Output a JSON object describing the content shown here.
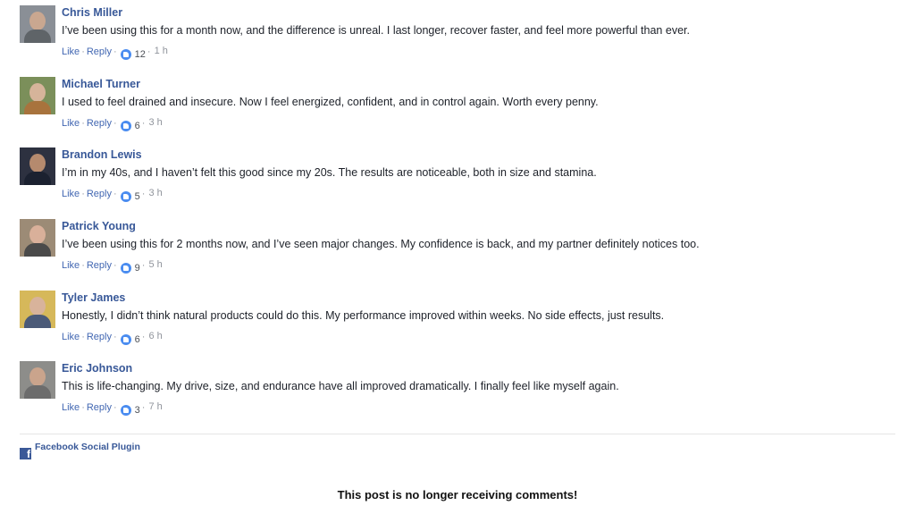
{
  "comments": [
    {
      "author": "Chris Miller",
      "text": "I’ve been using this for a month now, and the difference is unreal. I last longer, recover faster, and feel more powerful than ever.",
      "like": "Like",
      "reply": "Reply",
      "reactions": "12",
      "time": "1 h",
      "avatar_bg": "#8a8f96",
      "avatar_skin": "#c9a790",
      "avatar_shirt": "#5f6468"
    },
    {
      "author": "Michael Turner",
      "text": "I used to feel drained and insecure. Now I feel energized, confident, and in control again. Worth every penny.",
      "like": "Like",
      "reply": "Reply",
      "reactions": "6",
      "time": "3 h",
      "avatar_bg": "#7b8f5a",
      "avatar_skin": "#d6b49a",
      "avatar_shirt": "#a8733d"
    },
    {
      "author": "Brandon Lewis",
      "text": "I’m in my 40s, and I haven’t felt this good since my 20s. The results are noticeable, both in size and stamina.",
      "like": "Like",
      "reply": "Reply",
      "reactions": "5",
      "time": "3 h",
      "avatar_bg": "#2d3140",
      "avatar_skin": "#b58a6e",
      "avatar_shirt": "#1b2130"
    },
    {
      "author": "Patrick Young",
      "text": "I’ve been using this for 2 months now, and I’ve seen major changes. My confidence is back, and my partner definitely notices too.",
      "like": "Like",
      "reply": "Reply",
      "reactions": "9",
      "time": "5 h",
      "avatar_bg": "#9c8b76",
      "avatar_skin": "#d9b09a",
      "avatar_shirt": "#4a4a4a"
    },
    {
      "author": "Tyler James",
      "text": "Honestly, I didn’t think natural products could do this. My performance improved within weeks. No side effects, just results.",
      "like": "Like",
      "reply": "Reply",
      "reactions": "6",
      "time": "6 h",
      "avatar_bg": "#d6b85a",
      "avatar_skin": "#d8b39b",
      "avatar_shirt": "#4b5a78"
    },
    {
      "author": "Eric Johnson",
      "text": "This is life-changing. My drive, size, and endurance have all improved dramatically. I finally feel like myself again.",
      "like": "Like",
      "reply": "Reply",
      "reactions": "3",
      "time": "7 h",
      "avatar_bg": "#8d8d8a",
      "avatar_skin": "#caa48c",
      "avatar_shirt": "#6c6c6c"
    }
  ],
  "plugin": {
    "icon": "facebook-icon",
    "label": "Facebook Social Plugin"
  },
  "footer": {
    "closed_message": "This post is no longer receiving comments!"
  },
  "colors": {
    "author": "#385898",
    "link": "#4267b2",
    "like_icon": "#4a8cf0"
  }
}
